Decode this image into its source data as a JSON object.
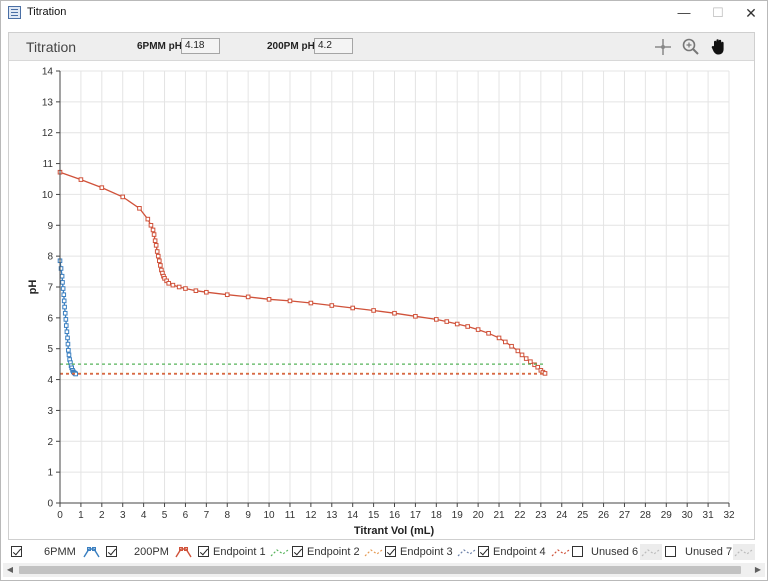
{
  "window": {
    "title": "Titration",
    "minimize": "—",
    "maximize": "☐",
    "close": "✕"
  },
  "toolbar": {
    "title": "Titration",
    "field1_label": "6PMM pH",
    "field1_value": "4.18",
    "field2_label": "200PM pH",
    "field2_value": "4.2",
    "tools": [
      "crosshair-icon",
      "zoom-icon",
      "pan-hand-icon"
    ]
  },
  "legend": {
    "items": [
      {
        "label": "6PMM",
        "checked": true,
        "color": "#3a7fc0"
      },
      {
        "label": "200PM",
        "checked": true,
        "color": "#d0523a"
      },
      {
        "label": "Endpoint 1",
        "checked": true,
        "color": "#56b35a"
      },
      {
        "label": "Endpoint 2",
        "checked": true,
        "color": "#e69a52"
      },
      {
        "label": "Endpoint 3",
        "checked": true,
        "color": "#6a7fa8"
      },
      {
        "label": "Endpoint 4",
        "checked": true,
        "color": "#d0523a"
      },
      {
        "label": "Unused 6",
        "checked": false,
        "color": "#bbbbbb"
      },
      {
        "label": "Unused 7",
        "checked": false,
        "color": "#bbbbbb"
      }
    ]
  },
  "chart_data": {
    "type": "line",
    "title": "",
    "xlabel": "Titrant Vol (mL)",
    "ylabel": "pH",
    "xlim": [
      0,
      32
    ],
    "ylim": [
      0,
      14
    ],
    "x_ticks": [
      0,
      1,
      2,
      3,
      4,
      5,
      6,
      7,
      8,
      9,
      10,
      11,
      12,
      13,
      14,
      15,
      16,
      17,
      18,
      19,
      20,
      21,
      22,
      23,
      24,
      25,
      26,
      27,
      28,
      29,
      30,
      31,
      32
    ],
    "y_ticks": [
      0,
      1,
      2,
      3,
      4,
      5,
      6,
      7,
      8,
      9,
      10,
      11,
      12,
      13,
      14
    ],
    "grid": true,
    "series": [
      {
        "name": "6PMM",
        "color": "#3a7fc0",
        "marker": "square",
        "x": [
          0.0,
          0.05,
          0.1,
          0.12,
          0.15,
          0.18,
          0.2,
          0.22,
          0.25,
          0.28,
          0.3,
          0.33,
          0.36,
          0.38,
          0.4,
          0.43,
          0.46,
          0.5,
          0.53,
          0.56,
          0.6,
          0.64,
          0.68,
          0.72,
          0.75
        ],
        "y": [
          7.85,
          7.6,
          7.35,
          7.15,
          6.95,
          6.75,
          6.55,
          6.35,
          6.15,
          5.95,
          5.75,
          5.55,
          5.35,
          5.15,
          4.95,
          4.8,
          4.65,
          4.55,
          4.45,
          4.38,
          4.3,
          4.25,
          4.22,
          4.2,
          4.18
        ]
      },
      {
        "name": "200PM",
        "color": "#d0523a",
        "marker": "square",
        "x": [
          0,
          1,
          2,
          3,
          3.8,
          4.2,
          4.35,
          4.45,
          4.5,
          4.55,
          4.6,
          4.65,
          4.7,
          4.75,
          4.8,
          4.85,
          4.9,
          4.95,
          5.0,
          5.1,
          5.2,
          5.4,
          5.7,
          6.0,
          6.5,
          7.0,
          8.0,
          9.0,
          10.0,
          11.0,
          12.0,
          13.0,
          14.0,
          15.0,
          16.0,
          17.0,
          18.0,
          18.5,
          19.0,
          19.5,
          20.0,
          20.5,
          21.0,
          21.3,
          21.6,
          21.9,
          22.1,
          22.3,
          22.5,
          22.7,
          22.85,
          23.0,
          23.1,
          23.2
        ],
        "y": [
          10.72,
          10.48,
          10.22,
          9.92,
          9.55,
          9.2,
          9.0,
          8.85,
          8.7,
          8.5,
          8.35,
          8.15,
          8.0,
          7.85,
          7.7,
          7.55,
          7.45,
          7.35,
          7.28,
          7.2,
          7.12,
          7.06,
          7.0,
          6.95,
          6.88,
          6.83,
          6.75,
          6.68,
          6.6,
          6.55,
          6.48,
          6.4,
          6.32,
          6.24,
          6.15,
          6.05,
          5.95,
          5.88,
          5.8,
          5.72,
          5.62,
          5.5,
          5.35,
          5.22,
          5.08,
          4.93,
          4.8,
          4.68,
          4.58,
          4.48,
          4.4,
          4.3,
          4.24,
          4.2
        ]
      },
      {
        "name": "Endpoint 1",
        "color": "#56b35a",
        "dashed": true,
        "x": [
          0,
          23.2
        ],
        "y": [
          4.5,
          4.5
        ]
      },
      {
        "name": "Endpoint 2",
        "color": "#e69a52",
        "dashed": true,
        "x": [
          0,
          23.2
        ],
        "y": [
          4.2,
          4.2
        ]
      },
      {
        "name": "Endpoint 4",
        "color": "#d0523a",
        "dashed": true,
        "x": [
          0,
          23.2
        ],
        "y": [
          4.18,
          4.18
        ]
      }
    ]
  }
}
